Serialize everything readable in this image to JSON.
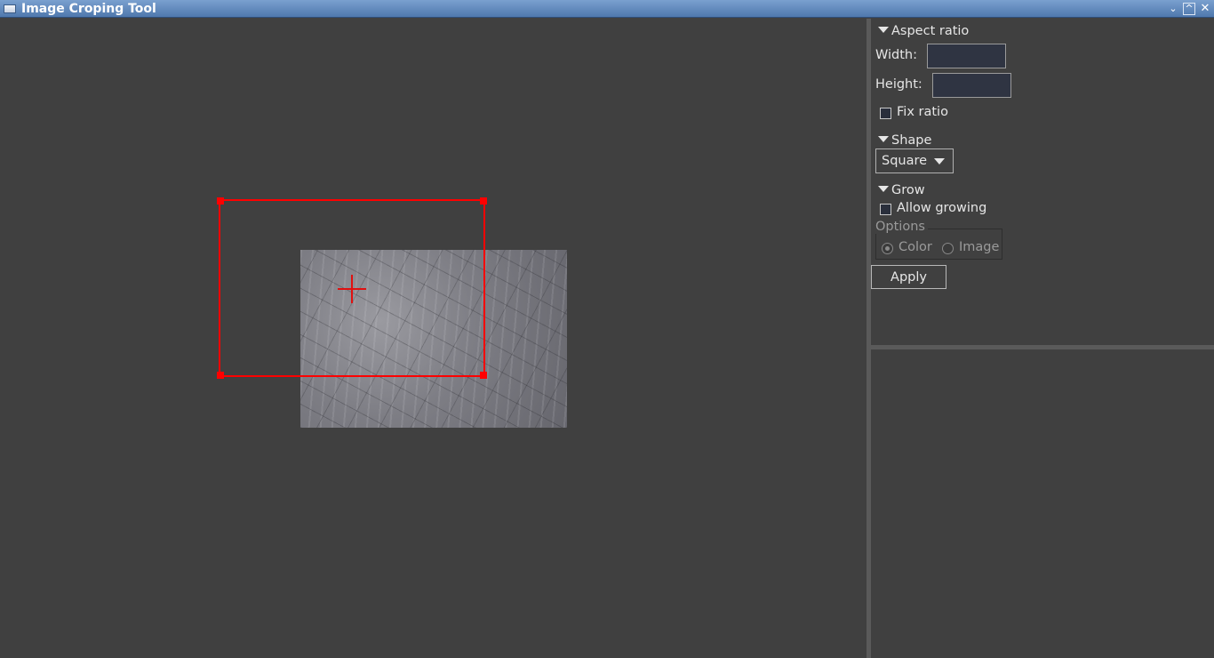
{
  "window": {
    "title": "Image Croping Tool",
    "buttons": {
      "minimize": "⌄",
      "maximize": "^",
      "close": "✕"
    }
  },
  "canvas": {
    "image_description": "stone-texture",
    "crop_color": "#ff0000"
  },
  "panel": {
    "aspect_ratio": {
      "heading": "Aspect ratio",
      "width_label": "Width:",
      "width_value": "",
      "height_label": "Height:",
      "height_value": "",
      "fix_ratio_label": "Fix ratio",
      "fix_ratio_checked": false
    },
    "shape": {
      "heading": "Shape",
      "selected": "Square"
    },
    "grow": {
      "heading": "Grow",
      "allow_growing_label": "Allow growing",
      "allow_growing_checked": false,
      "options_label": "Options",
      "option_color": "Color",
      "option_image": "Image",
      "selected_option": "Color"
    },
    "apply_label": "Apply"
  }
}
